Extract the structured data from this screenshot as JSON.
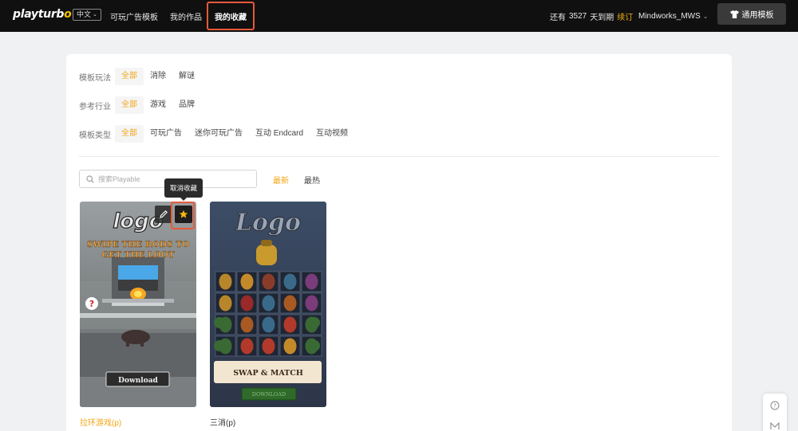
{
  "header": {
    "logo_part1": "playturb",
    "logo_part2": "o",
    "language": "中文",
    "nav": [
      {
        "label": "可玩广告模板"
      },
      {
        "label": "我的作品"
      },
      {
        "label": "我的收藏",
        "active": true
      }
    ],
    "expiry_prefix": "还有",
    "expiry_days": "3527",
    "expiry_suffix": "天到期",
    "renew_label": "续订",
    "username": "Mindworks_MWS",
    "template_button": "通用模板"
  },
  "filters": [
    {
      "label": "模板玩法",
      "options": [
        "全部",
        "消除",
        "解谜"
      ],
      "selected": 0
    },
    {
      "label": "参考行业",
      "options": [
        "全部",
        "游戏",
        "品牌"
      ],
      "selected": 0
    },
    {
      "label": "模板类型",
      "options": [
        "全部",
        "可玩广告",
        "迷你可玩广告",
        "互动 Endcard",
        "互动视频"
      ],
      "selected": 0
    }
  ],
  "search": {
    "placeholder": "搜索Playable",
    "value": ""
  },
  "sort": {
    "newest": "最新",
    "hottest": "最热",
    "selected": "newest"
  },
  "tooltip": "取消收藏",
  "cards": [
    {
      "title": "拉环游戏(p)",
      "title_color": "#f2a516",
      "logo_text": "logo",
      "headline_line1": "SWIPE THE RODS TO",
      "headline_line2": "GET THE LOOT",
      "download": "Download",
      "favorited": true
    },
    {
      "title": "三消(p)",
      "title_color": "#333333",
      "logo_text": "Logo",
      "banner": "SWAP & MATCH",
      "download": "DOWNLOAD"
    }
  ],
  "colors": {
    "accent": "#f2a516",
    "highlight_border": "#e8593a",
    "topbar": "#101010"
  }
}
